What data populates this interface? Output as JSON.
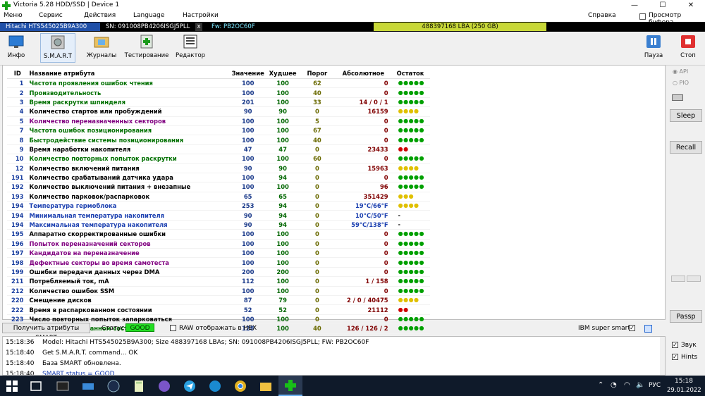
{
  "window": {
    "title": "Victoria 5.28 HDD/SSD | Device 1"
  },
  "menu": {
    "items": [
      "Меню",
      "Сервис",
      "Действия",
      "Language",
      "Настройки"
    ],
    "help": "Справка",
    "clipboard": "Просмотр буфера"
  },
  "device": {
    "model": "Hitachi HTS545025B9A300",
    "sn": "SN: 091008PB4206ISGJ5PLL",
    "close": "x",
    "fw": "Fw: PB2OC60F",
    "lba": "488397168 LBA (250 GB)"
  },
  "toolbar": {
    "info": "Инфо",
    "smart": "S.M.A.R.T",
    "logs": "Журналы",
    "test": "Тестирование",
    "editor": "Редактор",
    "pause": "Пауза",
    "stop": "Стоп"
  },
  "table": {
    "headers": {
      "id": "ID",
      "name": "Название атрибута",
      "value": "Значение",
      "worst": "Худшее",
      "threshold": "Порог",
      "raw": "Абсолютное",
      "health": "Остаток"
    },
    "rows": [
      {
        "id": "1",
        "name": "Частота проявления ошибок чтения",
        "value": "100",
        "worst": "100",
        "thr": "62",
        "raw": "0",
        "health": "●●●●●",
        "nc": "#007000",
        "hc": "#00a000"
      },
      {
        "id": "2",
        "name": "Производительность",
        "value": "100",
        "worst": "100",
        "thr": "40",
        "raw": "0",
        "health": "●●●●●",
        "nc": "#007000",
        "hc": "#00a000"
      },
      {
        "id": "3",
        "name": "Время раскрутки шпинделя",
        "value": "201",
        "worst": "100",
        "thr": "33",
        "raw": "14 / 0 / 1",
        "health": "●●●●●",
        "nc": "#007000",
        "hc": "#00a000"
      },
      {
        "id": "4",
        "name": "Количество стартов или пробуждений",
        "value": "90",
        "worst": "90",
        "thr": "0",
        "raw": "16159",
        "health": "●●●●",
        "nc": "#000000",
        "hc": "#e0c000"
      },
      {
        "id": "5",
        "name": "Количество переназначенных секторов",
        "value": "100",
        "worst": "100",
        "thr": "5",
        "raw": "0",
        "health": "●●●●●",
        "nc": "#800080",
        "hc": "#00a000"
      },
      {
        "id": "7",
        "name": "Частота ошибок позиционирования",
        "value": "100",
        "worst": "100",
        "thr": "67",
        "raw": "0",
        "health": "●●●●●",
        "nc": "#007000",
        "hc": "#00a000"
      },
      {
        "id": "8",
        "name": "Быстродействие системы позиционирования",
        "value": "100",
        "worst": "100",
        "thr": "40",
        "raw": "0",
        "health": "●●●●●",
        "nc": "#007000",
        "hc": "#00a000"
      },
      {
        "id": "9",
        "name": "Время наработки накопителя",
        "value": "47",
        "worst": "47",
        "thr": "0",
        "raw": "23433",
        "health": "●●",
        "nc": "#000000",
        "hc": "#d00000"
      },
      {
        "id": "10",
        "name": "Количество повторных попыток раскрутки",
        "value": "100",
        "worst": "100",
        "thr": "60",
        "raw": "0",
        "health": "●●●●●",
        "nc": "#007000",
        "hc": "#00a000"
      },
      {
        "id": "12",
        "name": "Количество включений питания",
        "value": "90",
        "worst": "90",
        "thr": "0",
        "raw": "15963",
        "health": "●●●●",
        "nc": "#000000",
        "hc": "#e0c000"
      },
      {
        "id": "191",
        "name": "Количество срабатываний датчика удара",
        "value": "100",
        "worst": "94",
        "thr": "0",
        "raw": "0",
        "health": "●●●●●",
        "nc": "#000000",
        "hc": "#00a000"
      },
      {
        "id": "192",
        "name": "Количество выключений питания + внезапные",
        "value": "100",
        "worst": "100",
        "thr": "0",
        "raw": "96",
        "health": "●●●●●",
        "nc": "#000000",
        "hc": "#00a000"
      },
      {
        "id": "193",
        "name": "Количество парковок/распарковок",
        "value": "65",
        "worst": "65",
        "thr": "0",
        "raw": "351429",
        "health": "●●●",
        "nc": "#000000",
        "hc": "#e0c000"
      },
      {
        "id": "194",
        "name": "Температура гермоблока",
        "value": "253",
        "worst": "94",
        "thr": "0",
        "raw": "19°C/66°F",
        "health": "●●●●",
        "nc": "#1a3fb0",
        "hc": "#e0c000",
        "rc": "#1a3fb0"
      },
      {
        "id": "194",
        "name": "Минимальная температура накопителя",
        "value": "90",
        "worst": "94",
        "thr": "0",
        "raw": "10°C/50°F",
        "health": "-",
        "nc": "#1a3fb0",
        "hc": "#000000",
        "rc": "#1a3fb0"
      },
      {
        "id": "194",
        "name": "Максимальная температура накопителя",
        "value": "90",
        "worst": "94",
        "thr": "0",
        "raw": "59°C/138°F",
        "health": "-",
        "nc": "#1a3fb0",
        "hc": "#000000",
        "rc": "#1a3fb0"
      },
      {
        "id": "195",
        "name": "Аппаратно скорректированные ошибки",
        "value": "100",
        "worst": "100",
        "thr": "0",
        "raw": "0",
        "health": "●●●●●",
        "nc": "#000000",
        "hc": "#00a000"
      },
      {
        "id": "196",
        "name": "Попыток переназначений секторов",
        "value": "100",
        "worst": "100",
        "thr": "0",
        "raw": "0",
        "health": "●●●●●",
        "nc": "#800080",
        "hc": "#00a000"
      },
      {
        "id": "197",
        "name": "Кандидатов на переназначение",
        "value": "100",
        "worst": "100",
        "thr": "0",
        "raw": "0",
        "health": "●●●●●",
        "nc": "#800080",
        "hc": "#00a000"
      },
      {
        "id": "198",
        "name": "Дефектные секторы во время самотеста",
        "value": "100",
        "worst": "100",
        "thr": "0",
        "raw": "0",
        "health": "●●●●●",
        "nc": "#800080",
        "hc": "#00a000"
      },
      {
        "id": "199",
        "name": "Ошибки передачи данных через DMA",
        "value": "200",
        "worst": "200",
        "thr": "0",
        "raw": "0",
        "health": "●●●●●",
        "nc": "#000000",
        "hc": "#00a000"
      },
      {
        "id": "211",
        "name": "Потребляемый ток, mA",
        "value": "112",
        "worst": "100",
        "thr": "0",
        "raw": "1 / 158",
        "health": "●●●●●",
        "nc": "#000000",
        "hc": "#00a000"
      },
      {
        "id": "212",
        "name": "Количество ошибок SSM",
        "value": "100",
        "worst": "100",
        "thr": "0",
        "raw": "0",
        "health": "●●●●●",
        "nc": "#000000",
        "hc": "#00a000"
      },
      {
        "id": "220",
        "name": "Смещение дисков",
        "value": "87",
        "worst": "79",
        "thr": "0",
        "raw": "2 / 0 / 40475",
        "health": "●●●●",
        "nc": "#000000",
        "hc": "#e0c000"
      },
      {
        "id": "222",
        "name": "Время в распаркованном состоянии",
        "value": "52",
        "worst": "52",
        "thr": "0",
        "raw": "21112",
        "health": "●●",
        "nc": "#000000",
        "hc": "#d00000"
      },
      {
        "id": "223",
        "name": "Число повторных попыток запарковаться",
        "value": "100",
        "worst": "100",
        "thr": "0",
        "raw": "0",
        "health": "●●●●●",
        "nc": "#000000",
        "hc": "#00a000"
      },
      {
        "id": "226",
        "name": "Время в запаркованном состоянии",
        "value": "128",
        "worst": "100",
        "thr": "40",
        "raw": "126 / 126 / 2",
        "health": "●●●●●",
        "nc": "#007000",
        "hc": "#00a000"
      }
    ]
  },
  "side": {
    "api": "API",
    "pio": "PIO",
    "sleep": "Sleep",
    "recall": "Recall",
    "passp": "Passp"
  },
  "status": {
    "get_button": "Получить атрибуты SMART",
    "label": "Статус:",
    "value": "GOOD",
    "raw_hex": "RAW отображать в HEX",
    "ibm": "IBM super smart:"
  },
  "log": {
    "lines": [
      {
        "time": "15:18:36",
        "text": "Model: Hitachi HTS545025B9A300; Size 488397168 LBAs; SN: 091008PB4206ISGJ5PLL; FW: PB2OC60F"
      },
      {
        "time": "15:18:40",
        "text": "Get S.M.A.R.T. command... OK"
      },
      {
        "time": "15:18:40",
        "text": "База SMART обновлена."
      },
      {
        "time": "15:18:40",
        "text": "SMART status = GOOD"
      }
    ],
    "sound": "Звук",
    "hints": "Hints"
  },
  "taskbar": {
    "lang": "РУС",
    "time": "15:18",
    "date": "29.01.2022"
  },
  "colors": {
    "accent": "#1f4fa8",
    "good": "#22dd22",
    "taskbar": "#0f1a2a"
  }
}
